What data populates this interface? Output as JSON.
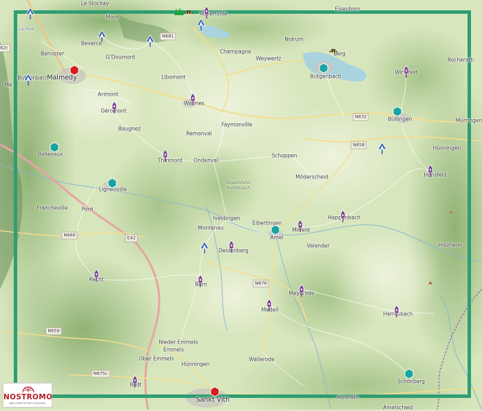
{
  "map": {
    "roads": {
      "n681": "N681",
      "n632": "N632",
      "n658": "N658",
      "n660": "N660",
      "e42": "E42",
      "n676": "N676",
      "n659": "N659",
      "n675c": "N675c",
      "n62c": "62c"
    },
    "labels": {
      "le_stockay": "Le Stockay",
      "mont": "Mont",
      "bernister": "Bernister",
      "beverce": "Beverce",
      "goumont": "G'Doumont",
      "bellevaux_wa": "Butgenbach",
      "malmedy": "Malmedy",
      "libomont": "Libomont",
      "arimont": "Arimont",
      "geromont": "Géromont",
      "baugnez": "Baugnez",
      "waimes": "Waimes",
      "remonval": "Remonval",
      "faymonville": "Faymonville",
      "champagne": "Champagne",
      "weywertz": "Weywertz",
      "nidrum": "Nidrum",
      "elsenborn": "Elsenborn",
      "butgenbach": "Bütgenbach",
      "berg": "Berg",
      "wirtzfeld": "Wirtzfeld",
      "rocherath": "Rocherath",
      "bullingen": "Büllingen",
      "murringen": "Mürringen",
      "hunningen_top": "Hünningen",
      "honsfeld": "Honsfeld",
      "bellevaux": "Bellevaux",
      "thirimont": "Thirimont",
      "ondenval": "Ondenval",
      "schoppen": "Schoppen",
      "moderscheid": "Möderscheid",
      "ligneuville": "Ligneuville",
      "francheville": "Francheville",
      "pont": "Pont",
      "iveldingen": "Iveldingen",
      "montenau": "Montenau",
      "eibertingen": "Eibertingen",
      "amel": "Amel",
      "mirfeld": "Mirfeld",
      "heppenbach": "Heppenbach",
      "valender": "Valender",
      "holzheim": "Holzheim",
      "deidenberg": "Deidenberg",
      "recht": "Recht",
      "born": "Born",
      "meyerode": "Meyerode",
      "medell": "Medell",
      "herresbach": "Herresbach",
      "nieder_emmels": "Nieder Emmels",
      "emmels": "Emmels",
      "ober_emmels": "Ober Emmels",
      "hunningen": "Hünningen",
      "wallerode": "Wallerode",
      "rodt": "Rodt",
      "sankt_vith": "Sankt Vith",
      "atzerath": "Atzerath",
      "schonberg": "Schönberg",
      "amelscheid": "Amelscheid",
      "forest": "Staatsforst Rohrbusch",
      "la_hoe": "La Hoë",
      "rosenville": "Robertville",
      "meuzz": "Me"
    },
    "pin_colors": {
      "purple": "#7b3f8f",
      "blue": "#2f5fb2",
      "teal": "#1aa3a3",
      "red": "#d41c1c",
      "black": "#222222",
      "green": "#23a33b"
    },
    "pin_types": {
      "purple": "church-pin-icon",
      "blue": "tent-pin-icon",
      "teal": "hexagon-pin-icon",
      "red": "hexagon-red-pin-icon",
      "black": "bunker-icon",
      "green": "forest-icon"
    },
    "frame_color": "#2e9e73"
  },
  "logo": {
    "name": "NOSTROMO",
    "tagline": "WEB COMPTOIR DES VOYAGEURS"
  }
}
